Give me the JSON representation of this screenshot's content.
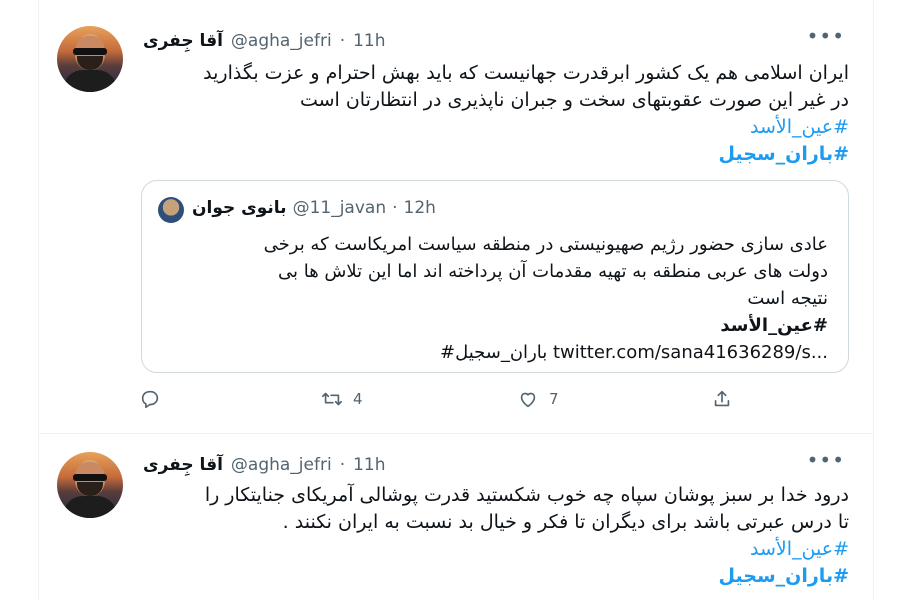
{
  "tweets": [
    {
      "display_name": "آقا جِفری",
      "handle": "@agha_jefri",
      "dot": "·",
      "time": "11h",
      "more_icon": "more-horizontal-icon",
      "text_lines": [
        "ایران اسلامی هم یک کشور ابرقدرت جهانیست که باید بهش احترام و عزت بگذارید",
        "در غیر این صورت عقوبتهای سخت و جبران ناپذیری در انتظارتان است"
      ],
      "hashtags": [
        "#عین_الأسد",
        "#باران_سجیل"
      ],
      "quote": {
        "display_name": "بانوی جوان",
        "handle": "@11_javan",
        "dot": "·",
        "time": "12h",
        "text_lines": [
          "عادی سازی حضور رژیم صهیونیستی در منطقه سیاست امریکاست که برخی",
          "دولت های عربی منطقه به تهیه مقدمات آن پرداخته اند اما این تلاش ها بی",
          "نتیجه است"
        ],
        "hashtag": "#عین_الأسد",
        "link_line": "#باران_سجیل twitter.com/sana41636289/s..."
      },
      "actions": {
        "reply_icon": "reply-icon",
        "retweet_icon": "retweet-icon",
        "retweet_count": "4",
        "like_icon": "heart-icon",
        "like_count": "7",
        "share_icon": "share-icon"
      }
    },
    {
      "display_name": "آقا جِفری",
      "handle": "@agha_jefri",
      "dot": "·",
      "time": "11h",
      "more_icon": "more-horizontal-icon",
      "text_lines": [
        "درود خدا بر سبز پوشان سپاه چه خوب شکستید قدرت پوشالی آمریکای جنایتکار را",
        "تا درس عبرتی باشد برای دیگران تا فکر و خیال بد نسبت به ایران نکنند ."
      ],
      "hashtags": [
        "#عین_الأسد",
        "#باران_سجیل"
      ]
    }
  ],
  "colors": {
    "accent": "#1d9bf0",
    "text": "#0f1419",
    "muted": "#536471",
    "border": "#cfd9de"
  }
}
